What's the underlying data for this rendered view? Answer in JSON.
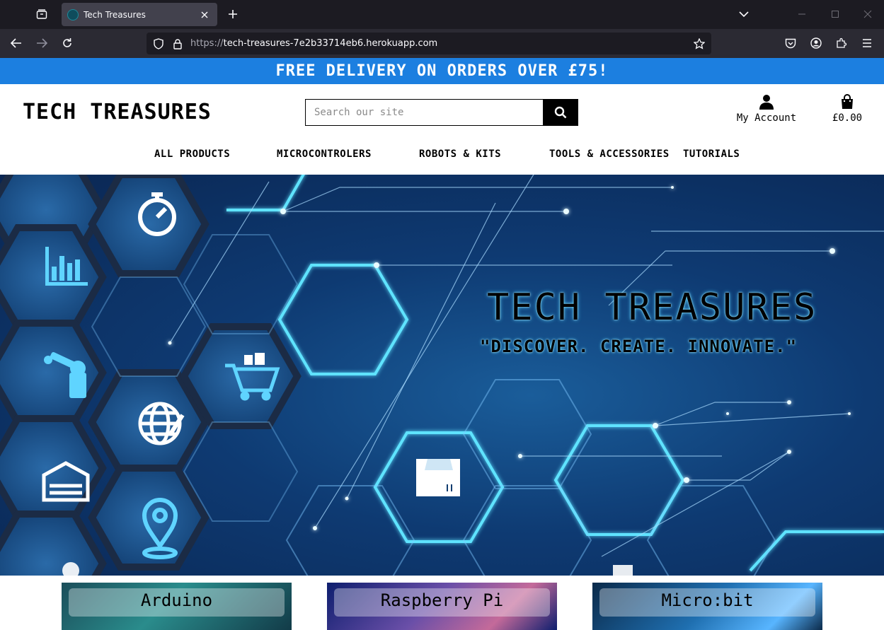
{
  "browser": {
    "tab_title": "Tech Treasures",
    "url_scheme": "https://",
    "url_host": "tech-treasures-7e2b33714eb6.herokuapp.com"
  },
  "promo": {
    "text": "FREE DELIVERY ON ORDERS OVER £75!"
  },
  "header": {
    "logo": "TECH TREASURES",
    "search_placeholder": "Search our site",
    "account_label": "My Account",
    "cart_total": "£0.00"
  },
  "nav": {
    "items": [
      "ALL PRODUCTS",
      "MICROCONTROLERS",
      "ROBOTS & KITS",
      "TOOLS & ACCESSORIES",
      "TUTORIALS"
    ]
  },
  "hero": {
    "title": "TECH TREASURES",
    "tagline": "\"DISCOVER. CREATE. INNOVATE.\""
  },
  "categories": [
    "Arduino",
    "Raspberry Pi",
    "Micro:bit"
  ],
  "colors": {
    "promo": "#1c7fe0",
    "chrome_dark": "#1c1b22",
    "accent_glow": "#4fd2ff"
  }
}
